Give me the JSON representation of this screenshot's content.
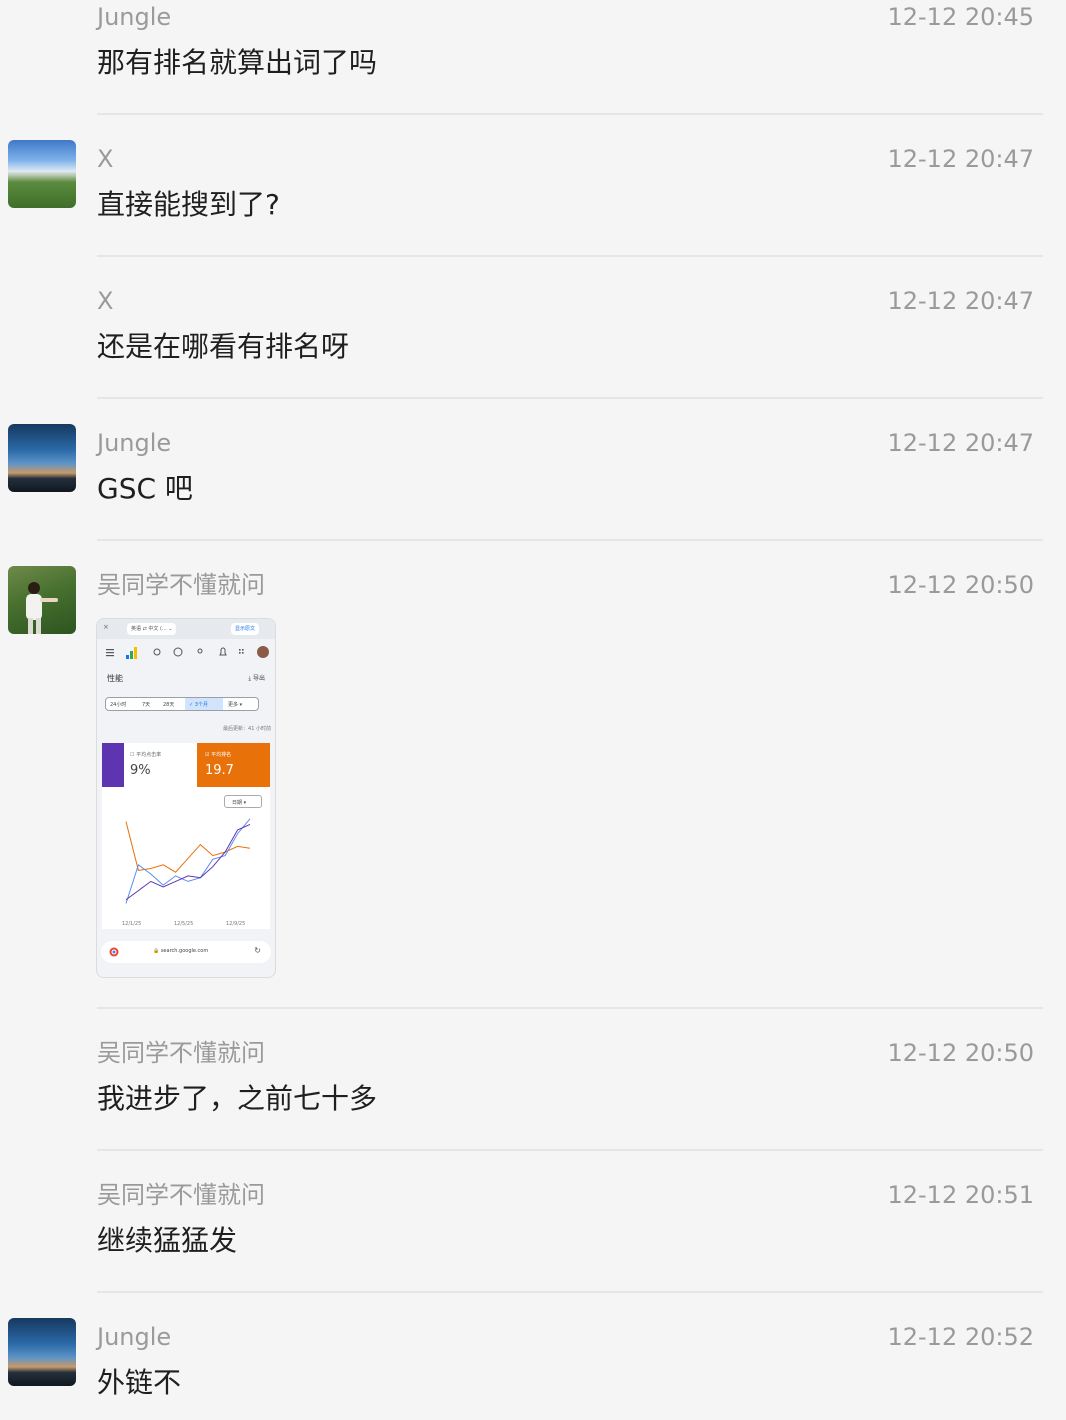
{
  "messages": [
    {
      "sender": "Jungle",
      "time": "12-12 20:45",
      "text": "那有排名就算出词了吗"
    },
    {
      "sender": "X",
      "time": "12-12 20:47",
      "text": "直接能搜到了?"
    },
    {
      "sender": "X",
      "time": "12-12 20:47",
      "text": "还是在哪看有排名呀"
    },
    {
      "sender": "Jungle",
      "time": "12-12 20:47",
      "text": "GSC 吧"
    },
    {
      "sender": "吴同学不懂就问",
      "time": "12-12 20:50",
      "text": ""
    },
    {
      "sender": "吴同学不懂就问",
      "time": "12-12 20:50",
      "text": "我进步了，之前七十多"
    },
    {
      "sender": "吴同学不懂就问",
      "time": "12-12 20:51",
      "text": "继续猛猛发"
    },
    {
      "sender": "Jungle",
      "time": "12-12 20:52",
      "text": "外链不"
    }
  ],
  "screenshot": {
    "tab_labels": [
      "英语",
      "中文 (...",
      "显示原文"
    ],
    "page_title": "性能",
    "export_label": "导出",
    "ranges": [
      "24小时",
      "7天",
      "28天",
      "✓ 3个月",
      "更多 ▾"
    ],
    "updated_text": "最后更新：41 小时前",
    "metric1_label": "平均点击率",
    "metric1_value": "9%",
    "metric2_label": "平均排名",
    "metric2_value": "19.7",
    "granularity": "日期 ▾",
    "x_ticks": [
      "12/1/25",
      "12/5/25",
      "12/9/25"
    ],
    "url": "search.google.com"
  },
  "chart_data": {
    "type": "line",
    "x": [
      "12/1/25",
      "12/2/25",
      "12/3/25",
      "12/4/25",
      "12/5/25",
      "12/6/25",
      "12/7/25",
      "12/8/25",
      "12/9/25",
      "12/10/25",
      "12/11/25"
    ],
    "series": [
      {
        "color": "#e8710a",
        "values": [
          0.95,
          0.42,
          0.44,
          0.48,
          0.4,
          0.55,
          0.7,
          0.58,
          0.62,
          0.68,
          0.66
        ]
      },
      {
        "color": "#5b8def",
        "values": [
          0.06,
          0.48,
          0.38,
          0.26,
          0.36,
          0.3,
          0.34,
          0.54,
          0.58,
          0.82,
          0.98
        ]
      },
      {
        "color": "#5e35b1",
        "values": [
          0.1,
          0.2,
          0.3,
          0.24,
          0.3,
          0.36,
          0.34,
          0.46,
          0.62,
          0.86,
          0.92
        ]
      }
    ],
    "grid": false,
    "legend": "none"
  }
}
